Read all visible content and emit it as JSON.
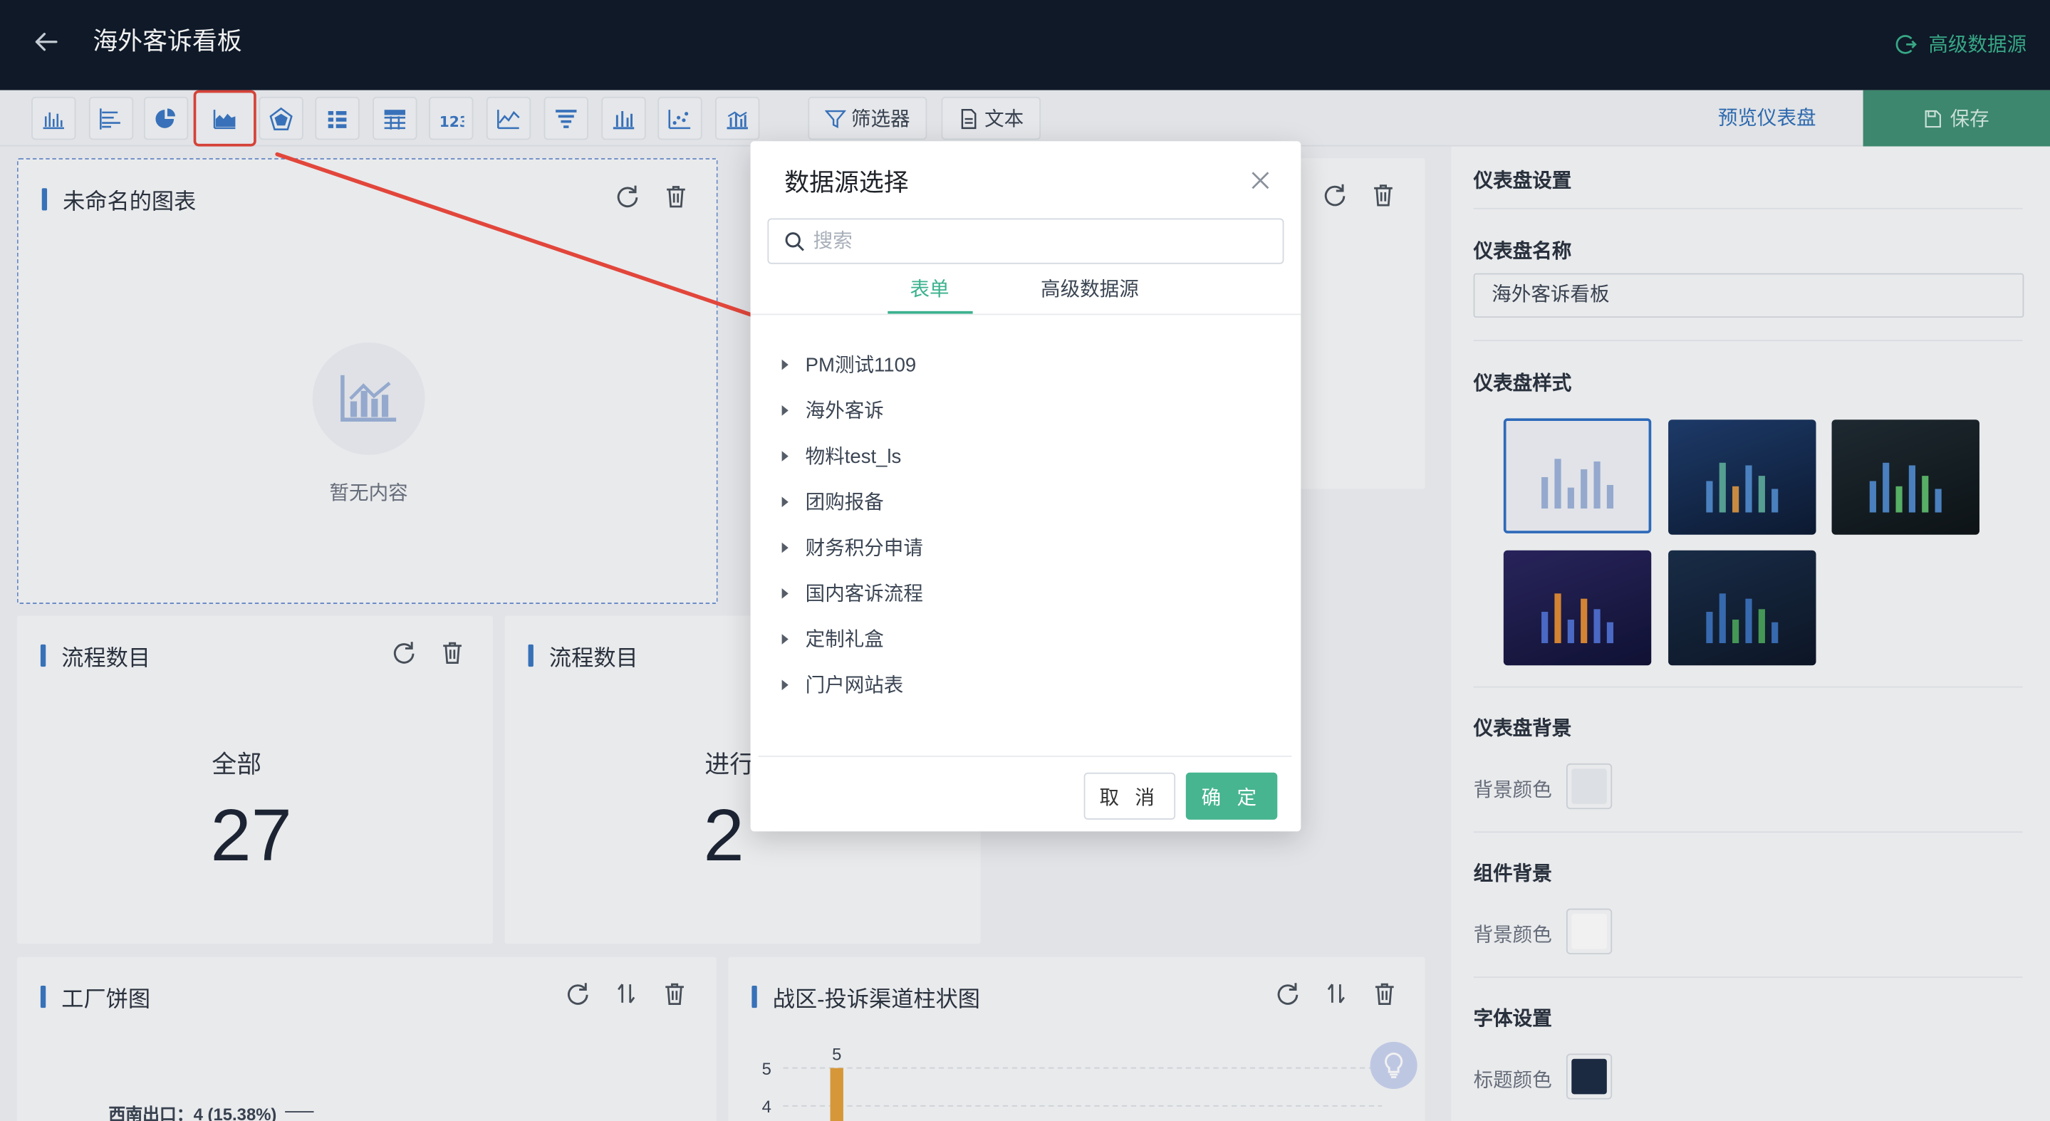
{
  "header": {
    "title": "海外客诉看板",
    "advanced_source": "高级数据源"
  },
  "toolbar": {
    "icons": [
      "bar-chart-icon",
      "horizontal-bar-icon",
      "pie-chart-icon",
      "area-chart-icon",
      "radar-chart-icon",
      "list-chart-icon",
      "table-chart-icon",
      "number-chart-icon",
      "line-chart-icon",
      "funnel-chart-icon",
      "column-chart-icon",
      "scatter-chart-icon",
      "combo-chart-icon"
    ],
    "filter": "筛选器",
    "text": "文本",
    "preview": "预览仪表盘",
    "save": "保存"
  },
  "cards": {
    "unnamed": {
      "title": "未命名的图表",
      "empty": "暂无内容"
    },
    "stat1": {
      "title": "流程数目",
      "label": "全部",
      "value": "27"
    },
    "stat2": {
      "title": "流程数目",
      "label": "进行",
      "value": "2"
    },
    "pie": {
      "title": "工厂饼图",
      "label": "西南出口：4 (15.38%)"
    },
    "bar": {
      "title": "战区-投诉渠道柱状图",
      "ticks": [
        "5",
        "4"
      ],
      "top_label": "5"
    }
  },
  "sidebar": {
    "settings": "仪表盘设置",
    "name_label": "仪表盘名称",
    "name_value": "海外客诉看板",
    "style_label": "仪表盘样式",
    "bg_label": "仪表盘背景",
    "bg_color_label": "背景颜色",
    "comp_bg_label": "组件背景",
    "comp_bg_color_label": "背景颜色",
    "font_label": "字体设置",
    "title_color_label": "标题颜色",
    "colors": {
      "dashboard_bg": "#e9edf2",
      "component_bg": "#ffffff",
      "title_color": "#1c2b45"
    }
  },
  "modal": {
    "title": "数据源选择",
    "search_placeholder": "搜索",
    "tabs": [
      "表单",
      "高级数据源"
    ],
    "items": [
      "PM测试1109",
      "海外客诉",
      "物料test_ls",
      "团购报备",
      "财务积分申请",
      "国内客诉流程",
      "定制礼盒",
      "门户网站表"
    ],
    "cancel": "取 消",
    "ok": "确 定"
  },
  "chart_data": {
    "type": "bar",
    "title": "战区-投诉渠道柱状图",
    "categories": [
      ""
    ],
    "values": [
      5
    ],
    "y_ticks": [
      4,
      5
    ],
    "colors": [
      "#e3a03b"
    ]
  }
}
